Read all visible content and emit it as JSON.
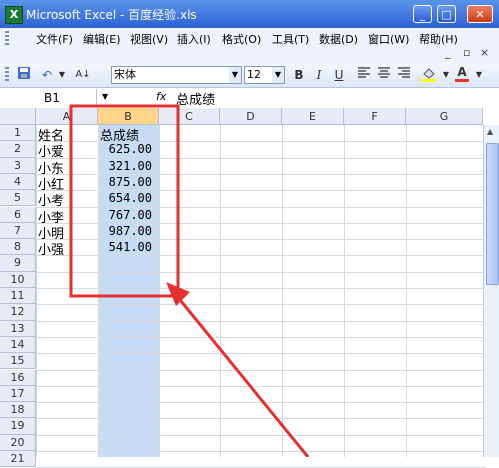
{
  "window": {
    "title": "Microsoft Excel - 百度经验.xls",
    "minimize": "_",
    "maximize": "□",
    "close": "✕"
  },
  "menu": [
    {
      "label": "文件(F)"
    },
    {
      "label": "编辑(E)"
    },
    {
      "label": "视图(V)"
    },
    {
      "label": "插入(I)"
    },
    {
      "label": "格式(O)"
    },
    {
      "label": "工具(T)"
    },
    {
      "label": "数据(D)"
    },
    {
      "label": "窗口(W)"
    },
    {
      "label": "帮助(H)"
    }
  ],
  "menu_controls": {
    "minimize": "_",
    "restore": "▫",
    "close": "×"
  },
  "toolbar": {
    "font": "宋体",
    "size": "12",
    "bold": "B",
    "italic": "I",
    "underline": "U"
  },
  "formula": {
    "name_box": "B1",
    "fx": "fx",
    "content": "总成绩"
  },
  "columns": [
    "A",
    "B",
    "C",
    "D",
    "E",
    "F",
    "G"
  ],
  "rows": [
    "1",
    "2",
    "3",
    "4",
    "5",
    "6",
    "7",
    "8",
    "9",
    "10",
    "11",
    "12",
    "13",
    "14",
    "15",
    "16",
    "17",
    "18",
    "19",
    "20",
    "21"
  ],
  "cells": {
    "A": [
      "姓名",
      "小爱",
      "小东",
      "小红",
      "小考",
      "小李",
      "小明",
      "小强"
    ],
    "B": [
      "总成绩",
      "625.00",
      "321.00",
      "875.00",
      "654.00",
      "767.00",
      "987.00",
      "541.00"
    ]
  },
  "colors": {
    "titlebar": "#2d62d6",
    "selection": "#c6dcf4",
    "annotation": "#e53030"
  }
}
